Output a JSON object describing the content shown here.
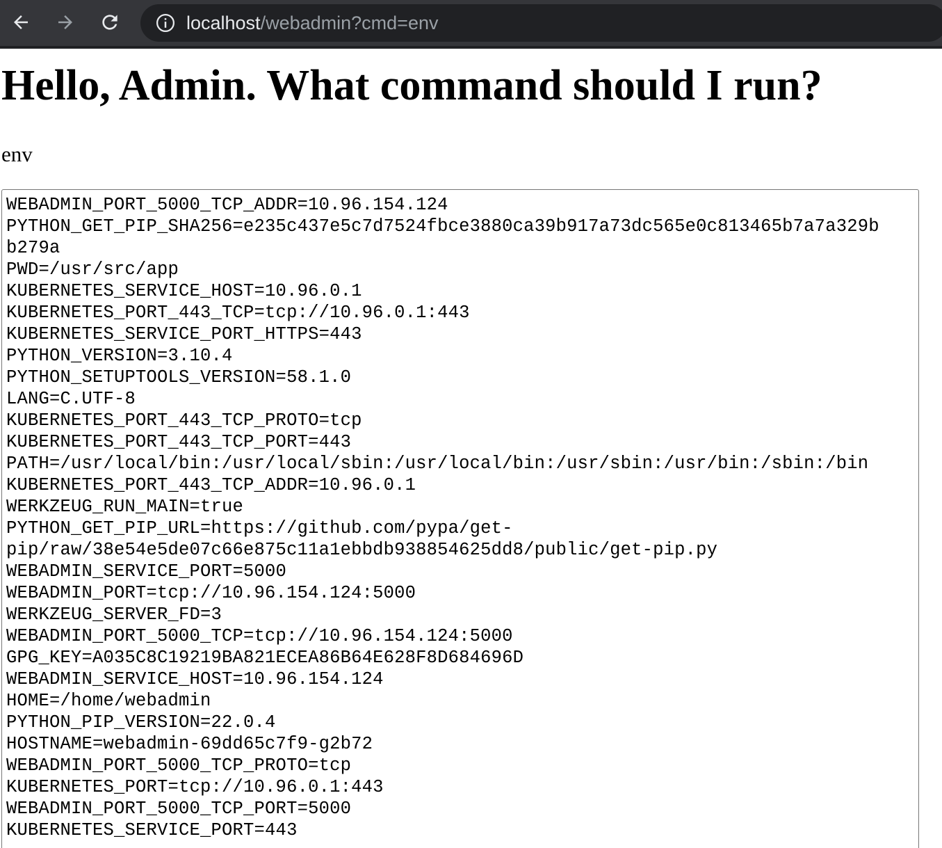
{
  "browser": {
    "back_icon": "arrow-left-icon",
    "forward_icon": "arrow-right-icon",
    "reload_icon": "reload-icon",
    "info_icon": "info-icon",
    "url_host": "localhost",
    "url_path": "/webadmin?cmd=env",
    "colors": {
      "toolbar": "#35363a",
      "address_bar": "#202124",
      "url_host": "#e8eaed",
      "url_path": "#9aa0a6"
    }
  },
  "page": {
    "heading": "Hello, Admin. What command should I run?",
    "command": "env",
    "output_lines": [
      "WEBADMIN_PORT_5000_TCP_ADDR=10.96.154.124",
      "PYTHON_GET_PIP_SHA256=e235c437e5c7d7524fbce3880ca39b917a73dc565e0c813465b7a7a329b",
      "b279a",
      "PWD=/usr/src/app",
      "KUBERNETES_SERVICE_HOST=10.96.0.1",
      "KUBERNETES_PORT_443_TCP=tcp://10.96.0.1:443",
      "KUBERNETES_SERVICE_PORT_HTTPS=443",
      "PYTHON_VERSION=3.10.4",
      "PYTHON_SETUPTOOLS_VERSION=58.1.0",
      "LANG=C.UTF-8",
      "KUBERNETES_PORT_443_TCP_PROTO=tcp",
      "KUBERNETES_PORT_443_TCP_PORT=443",
      "PATH=/usr/local/bin:/usr/local/sbin:/usr/local/bin:/usr/sbin:/usr/bin:/sbin:/bin",
      "KUBERNETES_PORT_443_TCP_ADDR=10.96.0.1",
      "WERKZEUG_RUN_MAIN=true",
      "PYTHON_GET_PIP_URL=https://github.com/pypa/get-",
      "pip/raw/38e54e5de07c66e875c11a1ebbdb938854625dd8/public/get-pip.py",
      "WEBADMIN_SERVICE_PORT=5000",
      "WEBADMIN_PORT=tcp://10.96.154.124:5000",
      "WERKZEUG_SERVER_FD=3",
      "WEBADMIN_PORT_5000_TCP=tcp://10.96.154.124:5000",
      "GPG_KEY=A035C8C19219BA821ECEA86B64E628F8D684696D",
      "WEBADMIN_SERVICE_HOST=10.96.154.124",
      "HOME=/home/webadmin",
      "PYTHON_PIP_VERSION=22.0.4",
      "HOSTNAME=webadmin-69dd65c7f9-g2b72",
      "WEBADMIN_PORT_5000_TCP_PROTO=tcp",
      "KUBERNETES_PORT=tcp://10.96.0.1:443",
      "WEBADMIN_PORT_5000_TCP_PORT=5000",
      "KUBERNETES_SERVICE_PORT=443"
    ]
  }
}
